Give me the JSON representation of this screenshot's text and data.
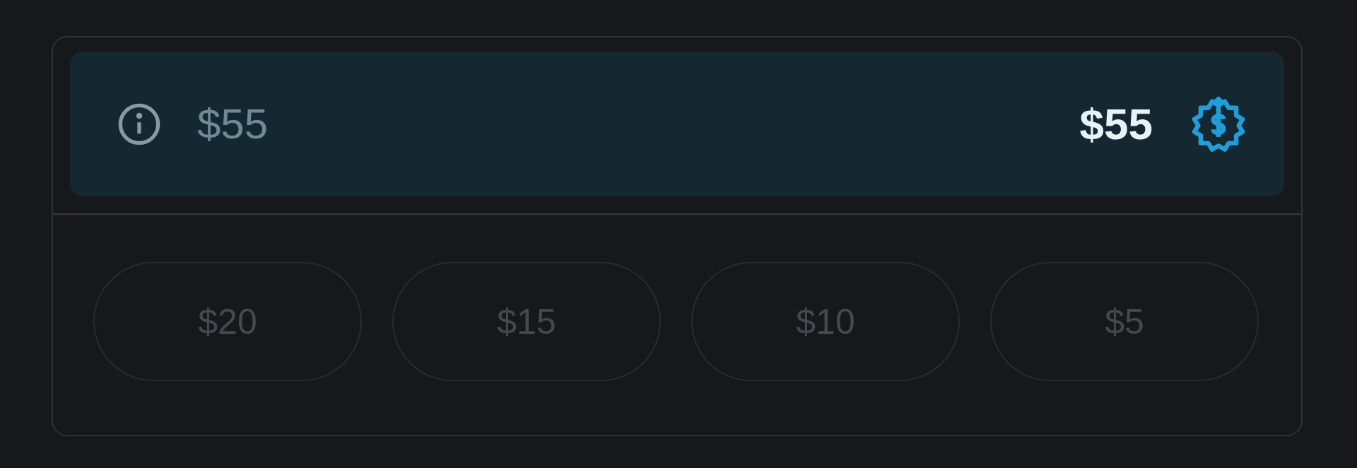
{
  "tip_panel": {
    "amount": "$55",
    "secondary_amount": "$55"
  },
  "presets": [
    {
      "label": "$20",
      "disabled": true
    },
    {
      "label": "$15",
      "disabled": true
    },
    {
      "label": "$10",
      "disabled": true
    },
    {
      "label": "$5",
      "disabled": true
    }
  ]
}
